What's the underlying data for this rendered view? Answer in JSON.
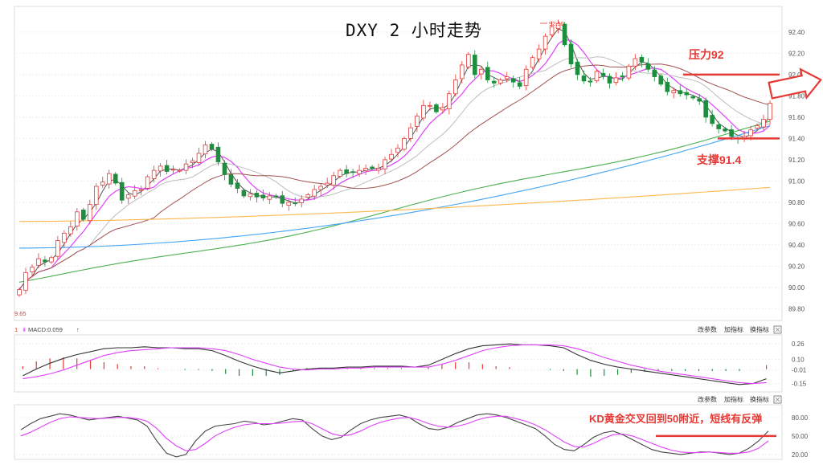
{
  "title": "DXY 2 小时走势",
  "annotations": {
    "resistance": "压力92",
    "support": "支撑91.4",
    "kd_note": "KD黄金交叉回到50附近，短线有反弹"
  },
  "indicator_bar": {
    "macd_label": "MACD:0.059",
    "buttons": [
      "改参数",
      "加指标",
      "换指标"
    ]
  },
  "price_labels": {
    "high_marker": "92.50",
    "low_marker": "9.65"
  },
  "colors": {
    "up": "#e53935",
    "down": "#1e8e3e",
    "annotation": "#e53935",
    "ma_fast": "#555555",
    "ma_pink": "#e040fb",
    "ma_gray": "#bdbdbd",
    "ma_brown": "#a0524f",
    "ma_green": "#4caf50",
    "ma_blue": "#42a5f5",
    "ma_orange": "#ffb74d"
  },
  "chart_data": [
    {
      "type": "candlestick",
      "title": "DXY 2 小时走势",
      "y_ticks": [
        "92.40",
        "92.20",
        "92.00",
        "91.80",
        "91.60",
        "91.40",
        "91.20",
        "91.00",
        "90.80",
        "90.60",
        "90.40",
        "90.20",
        "90.00",
        "89.80"
      ],
      "ylim": [
        89.72,
        92.55
      ],
      "grid": true,
      "resistance_level": 92.0,
      "support_level": 91.4,
      "close": [
        89.98,
        90.14,
        90.19,
        90.27,
        90.24,
        90.28,
        90.44,
        90.51,
        90.57,
        90.71,
        90.64,
        90.78,
        90.95,
        90.99,
        91.07,
        90.98,
        90.82,
        90.87,
        90.91,
        90.92,
        91.04,
        91.1,
        91.14,
        91.09,
        91.11,
        91.1,
        91.16,
        91.19,
        91.26,
        91.34,
        91.3,
        91.18,
        91.06,
        90.97,
        90.93,
        90.86,
        90.88,
        90.85,
        90.84,
        90.86,
        90.85,
        90.79,
        90.8,
        90.79,
        90.83,
        90.87,
        90.92,
        90.95,
        90.98,
        91.05,
        91.1,
        91.07,
        91.08,
        91.1,
        91.12,
        91.12,
        91.12,
        91.2,
        91.25,
        91.31,
        91.4,
        91.5,
        91.61,
        91.71,
        91.71,
        91.65,
        91.69,
        91.82,
        91.95,
        92.09,
        92.19,
        92.0,
        92.05,
        91.95,
        91.92,
        91.95,
        91.98,
        91.93,
        91.89,
        92.05,
        92.16,
        92.24,
        92.36,
        92.45,
        92.48,
        92.28,
        92.1,
        92.0,
        91.94,
        91.93,
        92.03,
        91.99,
        91.92,
        91.97,
        91.98,
        92.08,
        92.15,
        92.12,
        92.05,
        91.98,
        91.91,
        91.84,
        91.85,
        91.82,
        91.81,
        91.78,
        91.75,
        91.6,
        91.54,
        91.49,
        91.47,
        91.42,
        91.4,
        91.42,
        91.48,
        91.52,
        91.58,
        91.73
      ],
      "series": [
        {
          "name": "",
          "role": "ma_fast"
        },
        {
          "name": "",
          "role": "ma_pink"
        },
        {
          "name": "",
          "role": "ma_gray"
        },
        {
          "name": "",
          "role": "ma_brown"
        },
        {
          "name": "",
          "role": "ma_green"
        },
        {
          "name": "",
          "role": "ma_blue"
        },
        {
          "name": "",
          "role": "ma_orange"
        }
      ]
    },
    {
      "type": "macd",
      "label": "MACD:0.059",
      "y_ticks": [
        "0.26",
        "0.10",
        "-0.01",
        "-0.15"
      ],
      "ylim": [
        -0.22,
        0.32
      ],
      "dif": [
        -0.07,
        0.0,
        0.06,
        0.11,
        0.15,
        0.18,
        0.21,
        0.22,
        0.22,
        0.23,
        0.22,
        0.22,
        0.21,
        0.21,
        0.19,
        0.14,
        0.08,
        0.03,
        -0.01,
        -0.04,
        -0.02,
        0.0,
        0.01,
        0.01,
        0.02,
        0.02,
        0.03,
        0.03,
        0.03,
        0.02,
        0.04,
        0.1,
        0.16,
        0.21,
        0.24,
        0.25,
        0.26,
        0.25,
        0.25,
        0.24,
        0.22,
        0.15,
        0.09,
        0.05,
        0.02,
        0.0,
        -0.02,
        -0.04,
        -0.06,
        -0.08,
        -0.1,
        -0.12,
        -0.14,
        -0.16,
        -0.15,
        -0.1
      ],
      "dea": [
        -0.1,
        -0.08,
        -0.05,
        -0.01,
        0.04,
        0.09,
        0.14,
        0.17,
        0.19,
        0.2,
        0.21,
        0.22,
        0.22,
        0.22,
        0.21,
        0.19,
        0.15,
        0.1,
        0.06,
        0.02,
        0.0,
        -0.01,
        0.0,
        0.0,
        0.01,
        0.01,
        0.02,
        0.02,
        0.02,
        0.02,
        0.02,
        0.05,
        0.09,
        0.14,
        0.19,
        0.22,
        0.24,
        0.25,
        0.25,
        0.25,
        0.24,
        0.21,
        0.17,
        0.12,
        0.08,
        0.04,
        0.01,
        -0.02,
        -0.04,
        -0.06,
        -0.08,
        -0.1,
        -0.12,
        -0.14,
        -0.15,
        -0.14
      ],
      "hist": [
        0.03,
        0.08,
        0.11,
        0.12,
        0.11,
        0.09,
        0.07,
        0.05,
        0.03,
        0.03,
        0.01,
        0.0,
        -0.01,
        -0.01,
        -0.02,
        -0.05,
        -0.07,
        -0.07,
        -0.07,
        -0.06,
        -0.02,
        0.01,
        0.01,
        0.01,
        0.01,
        0.01,
        0.01,
        0.01,
        0.01,
        0.0,
        0.02,
        0.05,
        0.07,
        0.07,
        0.05,
        0.03,
        0.02,
        0.0,
        0.0,
        -0.01,
        -0.02,
        -0.06,
        -0.08,
        -0.07,
        -0.06,
        -0.04,
        -0.03,
        -0.02,
        -0.02,
        -0.02,
        -0.02,
        -0.02,
        -0.02,
        -0.02,
        0.0,
        0.04
      ]
    },
    {
      "type": "kd",
      "y_ticks": [
        "80.00",
        "50.00",
        "20.00"
      ],
      "ylim": [
        12,
        98
      ],
      "reference_level": 50,
      "k": [
        60,
        70,
        78,
        82,
        86,
        84,
        80,
        76,
        78,
        80,
        82,
        79,
        76,
        66,
        42,
        22,
        16,
        20,
        42,
        58,
        66,
        68,
        70,
        74,
        72,
        68,
        70,
        74,
        78,
        76,
        62,
        50,
        44,
        48,
        60,
        70,
        76,
        80,
        82,
        84,
        80,
        70,
        62,
        60,
        64,
        72,
        78,
        84,
        86,
        84,
        80,
        74,
        68,
        62,
        50,
        36,
        28,
        26,
        36,
        48,
        55,
        58,
        52,
        44,
        36,
        28,
        24,
        22,
        20,
        22,
        24,
        24,
        22,
        20,
        22,
        30,
        42,
        58
      ],
      "d": [
        50,
        56,
        64,
        72,
        78,
        81,
        80,
        79,
        78,
        79,
        80,
        80,
        78,
        74,
        62,
        46,
        34,
        26,
        28,
        38,
        50,
        58,
        64,
        68,
        70,
        70,
        70,
        71,
        73,
        74,
        70,
        62,
        54,
        50,
        52,
        58,
        66,
        72,
        76,
        79,
        80,
        76,
        70,
        66,
        64,
        66,
        70,
        76,
        80,
        82,
        82,
        78,
        74,
        68,
        60,
        50,
        40,
        33,
        32,
        38,
        46,
        52,
        53,
        50,
        44,
        38,
        32,
        27,
        24,
        23,
        23,
        24,
        23,
        22,
        22,
        24,
        30,
        42
      ]
    }
  ]
}
